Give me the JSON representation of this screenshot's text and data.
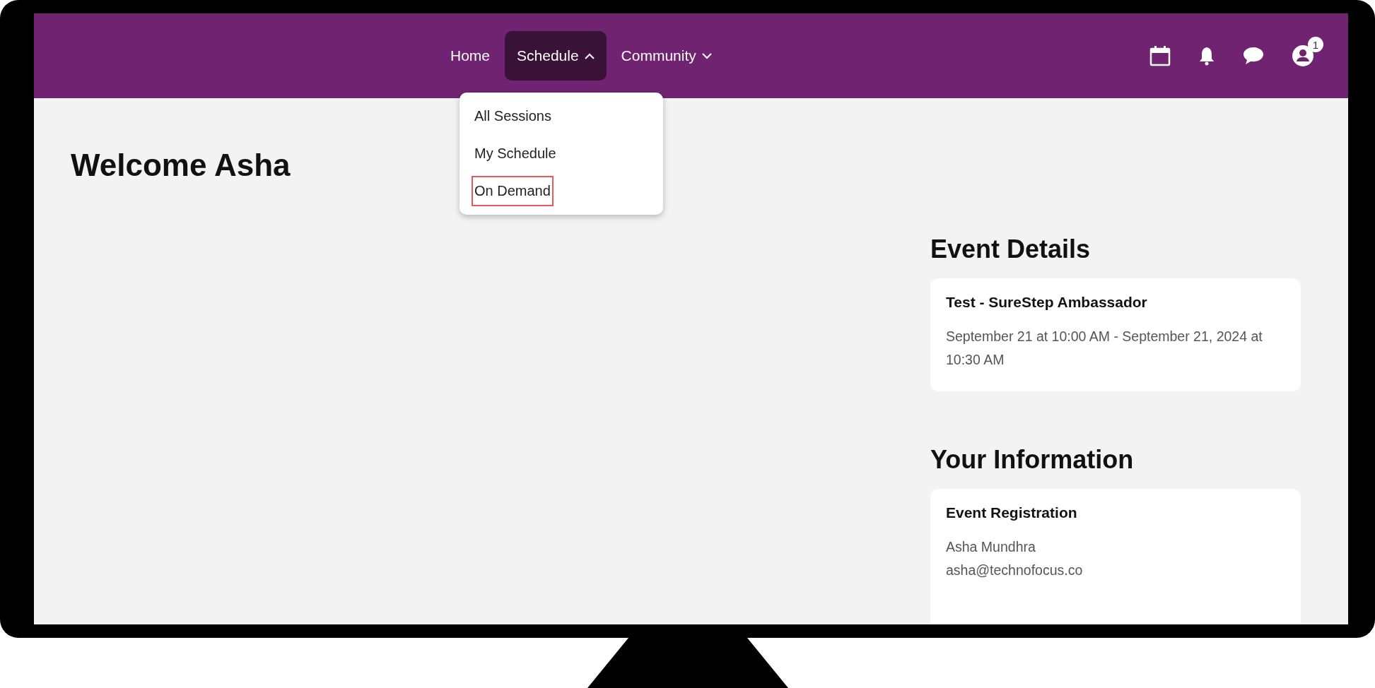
{
  "nav": {
    "items": [
      {
        "kind": "link",
        "label": "Home",
        "selected": false
      },
      {
        "kind": "menu",
        "label": "Schedule",
        "selected": true,
        "expanded": true
      },
      {
        "kind": "menu",
        "label": "Community",
        "selected": false,
        "expanded": false
      }
    ],
    "dropdown": [
      {
        "label": "All Sessions",
        "focused": false
      },
      {
        "label": "My Schedule",
        "focused": false
      },
      {
        "label": "On Demand",
        "focused": true
      }
    ],
    "notification_badge": "1"
  },
  "welcome": "Welcome Asha",
  "sections": [
    {
      "heading": "Event Details",
      "card": {
        "title": "Test - SureStep Ambassador",
        "lines": [
          "September 21 at 10:00 AM - September 21, 2024 at 10:30 AM"
        ]
      }
    },
    {
      "heading": "Your Information",
      "card": {
        "title": "Event Registration",
        "lines": [
          "Asha Mundhra",
          "asha@technofocus.co"
        ]
      }
    }
  ]
}
